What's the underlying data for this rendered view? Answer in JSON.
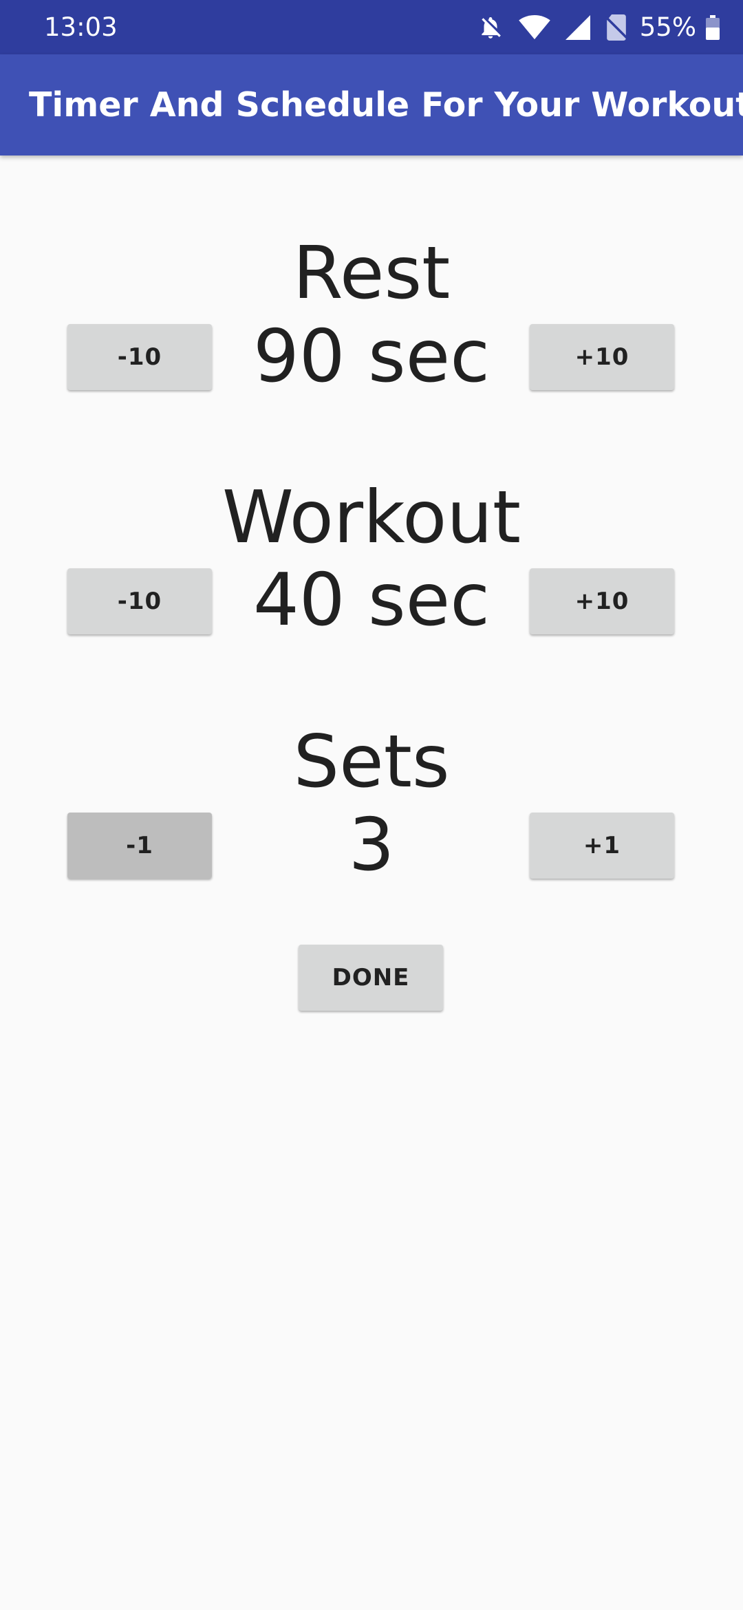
{
  "status_bar": {
    "time": "13:03",
    "battery_percent": "55%",
    "icons": [
      "bell-off-icon",
      "wifi-icon",
      "cell-signal-icon",
      "no-sim-icon",
      "battery-icon"
    ]
  },
  "app_bar": {
    "title": "Timer And Schedule For Your Workout",
    "color": "#3f51b5"
  },
  "rest": {
    "label": "Rest",
    "value": "90 sec",
    "decrement_label": "-10",
    "increment_label": "+10"
  },
  "workout": {
    "label": "Workout",
    "value": "40 sec",
    "decrement_label": "-10",
    "increment_label": "+10"
  },
  "sets": {
    "label": "Sets",
    "value": "3",
    "decrement_label": "-1",
    "increment_label": "+1"
  },
  "done_label": "DONE"
}
